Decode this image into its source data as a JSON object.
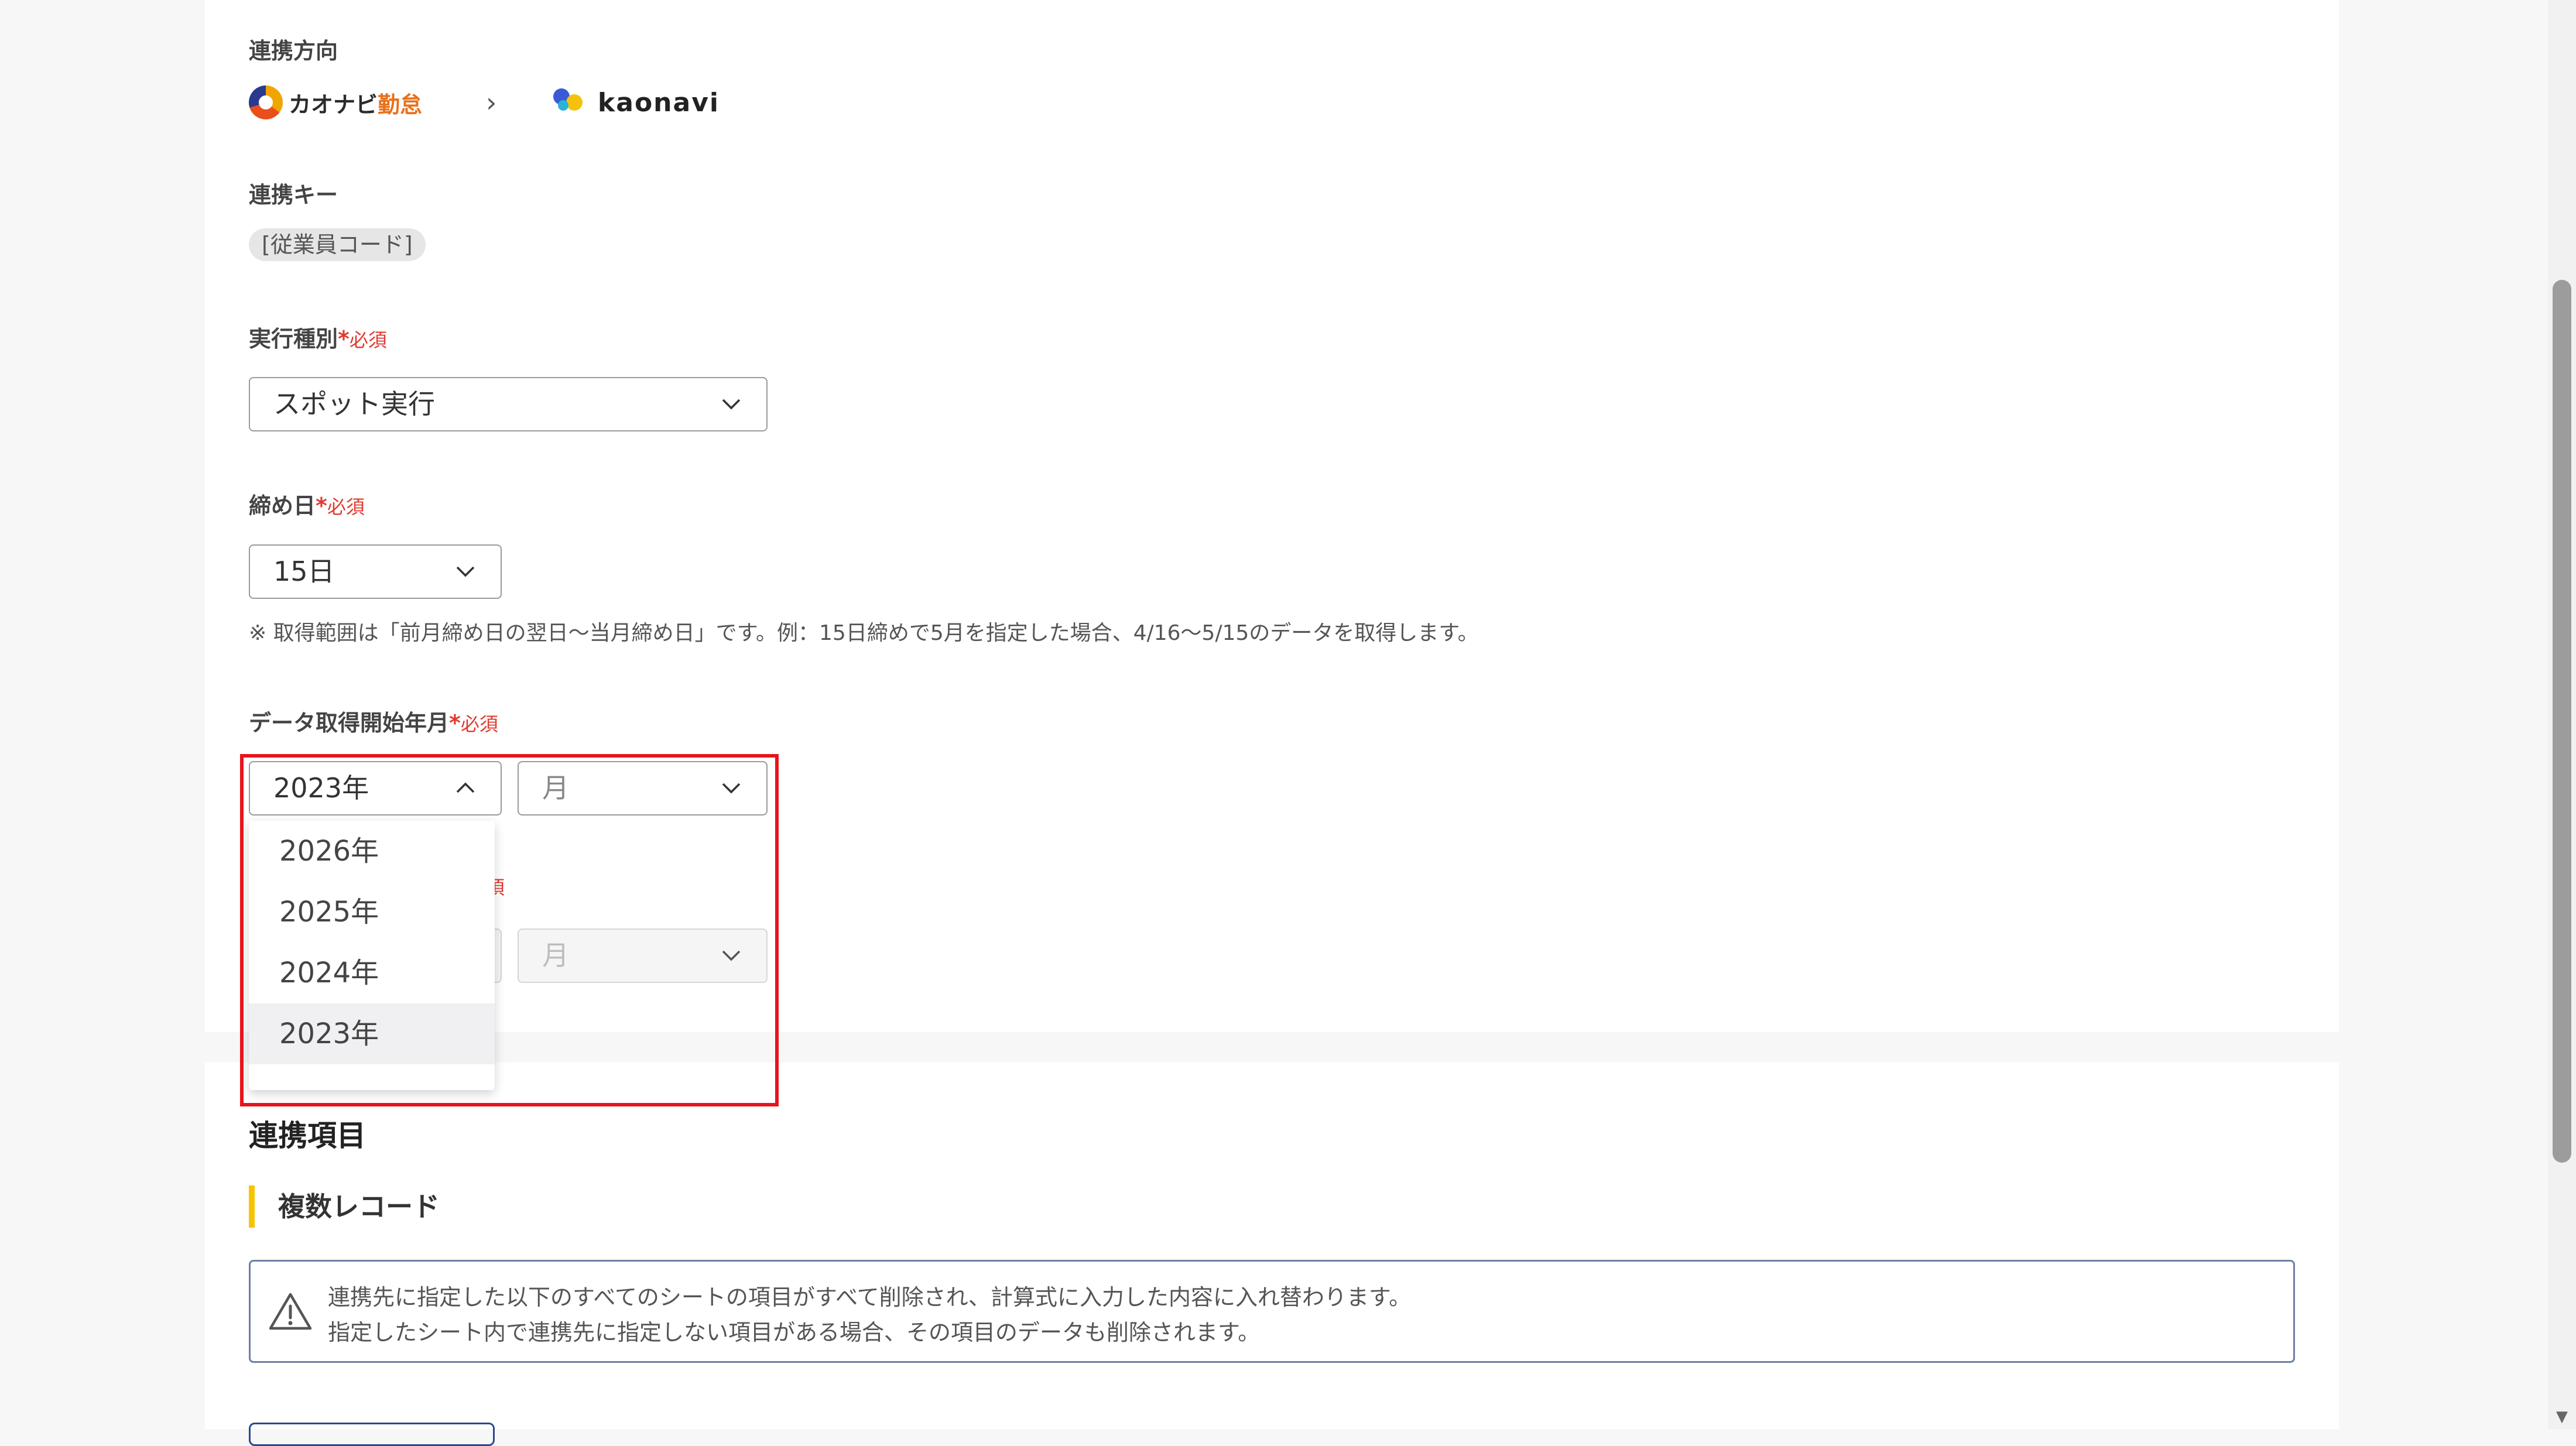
{
  "direction": {
    "label": "連携方向",
    "source_logo_text_a": "カオナビ",
    "source_logo_text_b": "勤怠",
    "target_logo_text": "kaonavi"
  },
  "key": {
    "label": "連携キー",
    "tag": "[従業員コード]"
  },
  "exec_type": {
    "label": "実行種別",
    "required": "必須",
    "value": "スポット実行"
  },
  "closing_day": {
    "label": "締め日",
    "required": "必須",
    "value": "15日",
    "note": "※ 取得範囲は「前月締め日の翌日〜当月締め日」です。例：15日締めで5月を指定した場合、4/16〜5/15のデータを取得します。"
  },
  "start_month": {
    "label": "データ取得開始年月",
    "required": "必須",
    "year_value": "2023年",
    "month_placeholder": "月",
    "year_options": [
      "2026年",
      "2025年",
      "2024年",
      "2023年"
    ],
    "selected_option": "2023年"
  },
  "end_month": {
    "required_partial": "須",
    "month_placeholder": "月"
  },
  "items_section": {
    "title": "連携項目",
    "subtitle": "複数レコード",
    "warning_line1": "連携先に指定した以下のすべてのシートの項目がすべて削除され、計算式に入力した内容に入れ替わります。",
    "warning_line2": "指定したシート内で連携先に指定しない項目がある場合、その項目のデータも削除されます。"
  },
  "colors": {
    "required": "#e03a2f",
    "highlight": "#e8141c",
    "accent_bar": "#f5c400"
  }
}
